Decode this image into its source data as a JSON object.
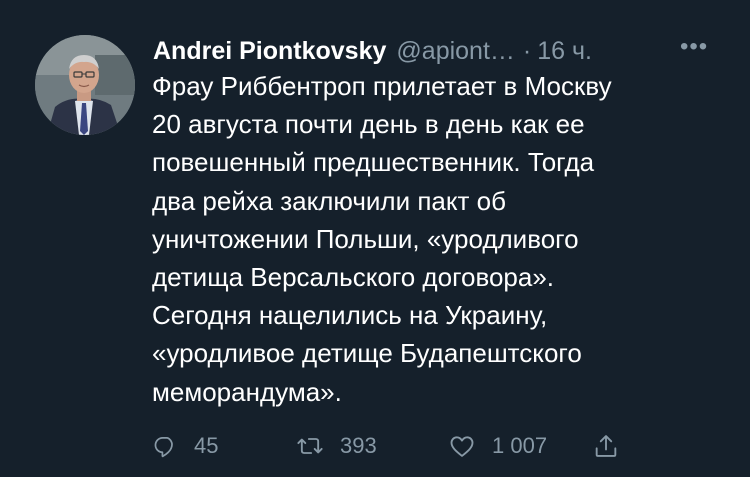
{
  "tweet": {
    "display_name": "Andrei Piontkovsky",
    "handle": "@apiont…",
    "separator": "·",
    "time": "16 ч.",
    "more_label": "•••",
    "text": "Фрау Риббентроп прилетает в Москву\n20 августа почти день в день как ее\nповешенный предшественник. Тогда\nдва рейха заключили пакт об\nуничтожении Польши, «уродливого\nдетища Версальского договора».\nСегодня нацелились на Украину,\n«уродливое детище Будапештского\nмеморандума».",
    "actions": {
      "reply_count": "45",
      "retweet_count": "393",
      "like_count": "1 007"
    }
  },
  "icons": {
    "avatar": "profile-photo",
    "reply": "speech-bubble-icon",
    "retweet": "retweet-arrows-icon",
    "like": "heart-outline-icon",
    "share": "share-upload-icon",
    "more": "more-dots-icon"
  },
  "colors": {
    "background": "#15202b",
    "text_primary": "#ffffff",
    "text_secondary": "#8899a6"
  }
}
